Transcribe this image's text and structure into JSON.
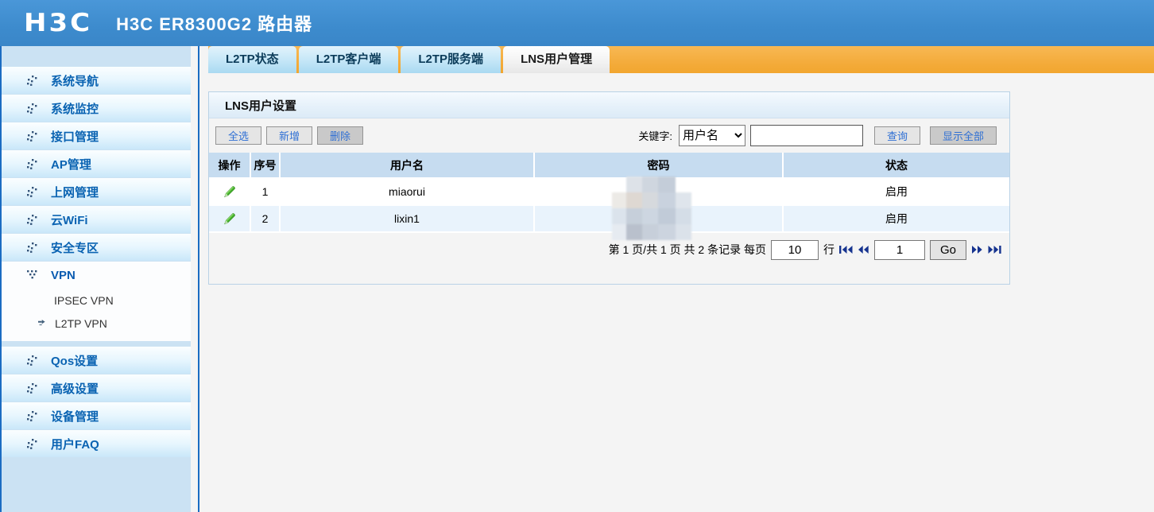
{
  "header": {
    "logo": "H3C",
    "title": "H3C ER8300G2 路由器"
  },
  "tabs": [
    {
      "label": "L2TP状态",
      "active": false
    },
    {
      "label": "L2TP客户端",
      "active": false
    },
    {
      "label": "L2TP服务端",
      "active": false
    },
    {
      "label": "LNS用户管理",
      "active": true
    }
  ],
  "sidebar": {
    "items": [
      {
        "label": "系统导航"
      },
      {
        "label": "系统监控"
      },
      {
        "label": "接口管理"
      },
      {
        "label": "AP管理"
      },
      {
        "label": "上网管理"
      },
      {
        "label": "云WiFi"
      },
      {
        "label": "安全专区"
      },
      {
        "label": "VPN",
        "expanded": true,
        "children": [
          {
            "label": "IPSEC VPN",
            "selected": false
          },
          {
            "label": "L2TP VPN",
            "selected": true
          }
        ]
      },
      {
        "label": "Qos设置"
      },
      {
        "label": "高级设置"
      },
      {
        "label": "设备管理"
      },
      {
        "label": "用户FAQ"
      }
    ]
  },
  "panel": {
    "title": "LNS用户设置",
    "toolbar": {
      "select_all": "全选",
      "add": "新增",
      "delete": "删除",
      "keyword_label": "关键字:",
      "keyword_selected": "用户名",
      "search_value": "",
      "search_placeholder": "",
      "query": "查询",
      "show_all": "显示全部"
    },
    "table": {
      "headers": [
        "操作",
        "序号",
        "用户名",
        "密码",
        "状态"
      ],
      "rows": [
        {
          "index": "1",
          "username": "miaorui",
          "password_masked": "",
          "status": "启用"
        },
        {
          "index": "2",
          "username": "lixin1",
          "password_masked": "",
          "status": "启用"
        }
      ]
    },
    "pagination": {
      "summary": "第 1 页/共 1 页 共 2 条记录 每页",
      "rows_per_page": "10",
      "rows_label": "行",
      "goto_value": "1",
      "go_label": "Go"
    }
  },
  "colors": {
    "header_blue": "#3d8bcd",
    "tab_orange": "#f3aa38",
    "sidebar_link_blue": "#0a63b2",
    "table_header_blue": "#c6dcf0",
    "row_alt_blue": "#e9f3fc",
    "button_text_blue": "#2e6fd4",
    "pencil_green": "#45b02c",
    "pager_navy": "#16338f"
  }
}
